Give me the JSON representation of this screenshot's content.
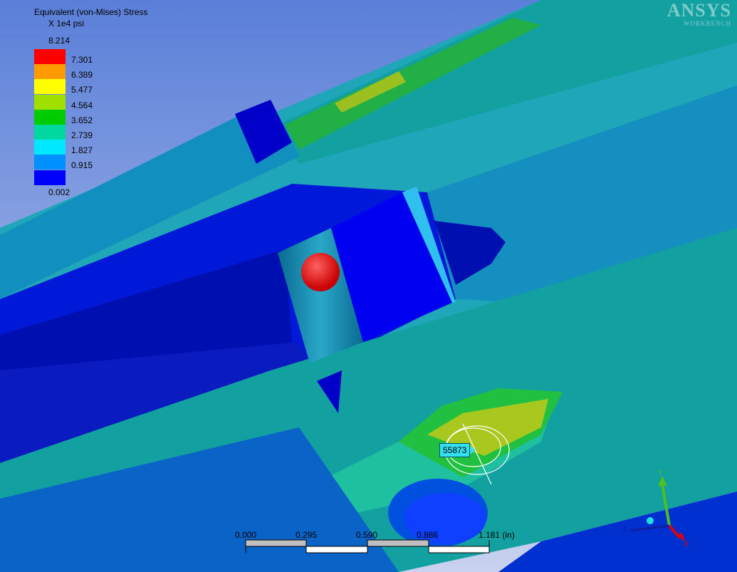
{
  "legend": {
    "title": "Equivalent (von-Mises) Stress",
    "unit": "X 1e4 psi",
    "max": "8.214",
    "min": "0.002",
    "bands": [
      {
        "label": "7.301",
        "color": "#ff0000"
      },
      {
        "label": "6.389",
        "color": "#ff9a00"
      },
      {
        "label": "5.477",
        "color": "#ffff00"
      },
      {
        "label": "4.564",
        "color": "#a0e000"
      },
      {
        "label": "3.652",
        "color": "#00cc00"
      },
      {
        "label": "2.739",
        "color": "#00d8a0"
      },
      {
        "label": "1.827",
        "color": "#00e8ff"
      },
      {
        "label": "0.915",
        "color": "#0090ff"
      },
      {
        "label": "",
        "color": "#0000ff"
      }
    ]
  },
  "logo": {
    "line1": "ANSYS",
    "line2": "WORKBENCH"
  },
  "probe": {
    "value": "55873"
  },
  "scale_bar": {
    "ticks": [
      "0.000",
      "0.295",
      "0.590",
      "0.886",
      "1.181 (in)"
    ]
  },
  "triad": {
    "y": "Y",
    "z": "Z",
    "x": "X"
  }
}
